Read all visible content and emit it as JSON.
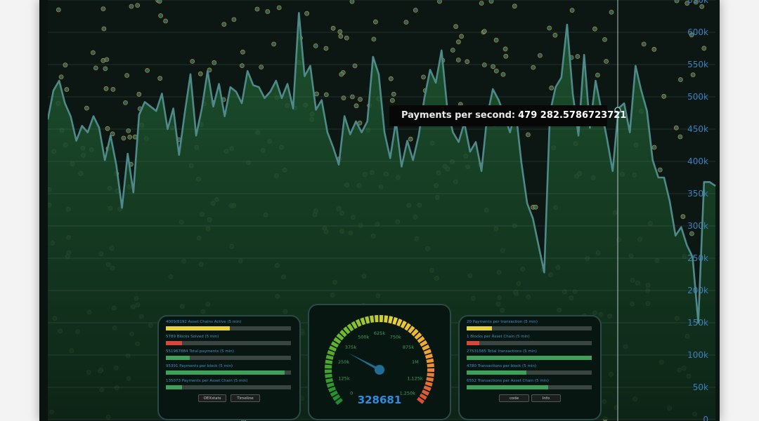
{
  "chart_data": {
    "type": "area",
    "y_ticks": [
      "650k",
      "600k",
      "550k",
      "500k",
      "450k",
      "400k",
      "350k",
      "300k",
      "250k",
      "200k",
      "150k",
      "100k",
      "50k",
      "0"
    ],
    "ylim": [
      0,
      650000
    ],
    "grid": true,
    "series": [
      {
        "values": [
          465000,
          510000,
          525000,
          490000,
          470000,
          432000,
          455000,
          445000,
          470000,
          452000,
          402000,
          440000,
          395000,
          328000,
          412000,
          352000,
          472000,
          492000,
          485000,
          478000,
          505000,
          450000,
          482000,
          410000,
          475000,
          535000,
          440000,
          482000,
          540000,
          485000,
          520000,
          470000,
          515000,
          508000,
          490000,
          540000,
          518000,
          515000,
          498000,
          508000,
          525000,
          498000,
          520000,
          482000,
          630000,
          532000,
          548000,
          480000,
          495000,
          445000,
          422000,
          395000,
          470000,
          442000,
          462000,
          445000,
          462000,
          562000,
          535000,
          445000,
          405000,
          462000,
          392000,
          432000,
          402000,
          440000,
          498000,
          542000,
          522000,
          572000,
          482000,
          445000,
          430000,
          460000,
          415000,
          430000,
          385000,
          470000,
          512000,
          495000,
          472000,
          445000,
          478000,
          398000,
          335000,
          312000,
          270000,
          228000,
          475000,
          515000,
          530000,
          612000,
          505000,
          440000,
          565000,
          452000,
          525000,
          480000,
          435000,
          385000,
          482000,
          490000,
          445000,
          548000,
          510000,
          478000,
          402000,
          375000,
          375000,
          338000,
          285000,
          298000,
          270000,
          252000,
          150000,
          368000,
          368000,
          362000
        ]
      }
    ]
  },
  "tooltip": {
    "label": "Payments per second:",
    "value": "479 282.5786723721"
  },
  "left_panel": {
    "metrics": [
      {
        "label": "4009/8192 Asset Chains Active (5 min)",
        "fraction": 0.51,
        "color": "#e8d23a"
      },
      {
        "label": "5789 Blocks Solved (5 min)",
        "fraction": 0.13,
        "color": "#d8473a"
      },
      {
        "label": "551967884 Total payments (5 min)",
        "fraction": 0.19,
        "color": "#3ea05a"
      },
      {
        "label": "95391 Payments per block (5 min)",
        "fraction": 0.95,
        "color": "#3ea05a"
      },
      {
        "label": "135073 Payments per Asset Chain (5 min)",
        "fraction": 0.13,
        "color": "#3ea05a"
      }
    ],
    "buttons": [
      "OEXstats",
      "Timeline"
    ]
  },
  "right_panel": {
    "metrics": [
      {
        "label": "20 Payments per transaction (5 min)",
        "fraction": 0.2,
        "color": "#e8d23a"
      },
      {
        "label": "1 Blocks per Asset Chain (5 min)",
        "fraction": 0.1,
        "color": "#d8473a"
      },
      {
        "label": "27531585 Total transactions (5 min)",
        "fraction": 1.0,
        "color": "#3ea05a"
      },
      {
        "label": "4780 Transactions per block (5 min)",
        "fraction": 0.48,
        "color": "#3ea05a"
      },
      {
        "label": "6552 Transactions per Asset Chain (5 min)",
        "fraction": 0.65,
        "color": "#3ea05a"
      }
    ],
    "buttons": [
      "code",
      "Info"
    ]
  },
  "gauge": {
    "value": "328681",
    "value_number": 328681,
    "max": 1250000,
    "tick_labels": [
      "0",
      "125k",
      "250k",
      "375k",
      "500k",
      "625k",
      "750k",
      "875k",
      "1M",
      "1,125k",
      "1,250k"
    ],
    "value_color": "#2b8ce0"
  }
}
